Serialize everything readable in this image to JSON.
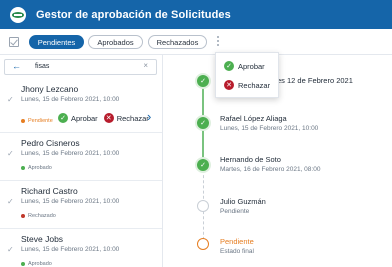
{
  "header": {
    "title": "Gestor de aprobación de Solicitudes"
  },
  "toolbar": {
    "tabs": [
      {
        "label": "Pendientes"
      },
      {
        "label": "Aprobados"
      },
      {
        "label": "Rechazados"
      }
    ]
  },
  "search": {
    "back_icon": "←",
    "value": "fisas",
    "clear_icon": "×"
  },
  "requests": [
    {
      "name": "Jhony Lezcano",
      "date": "Lunes, 15 de Febrero 2021, 10:00",
      "status": "Pendiente",
      "status_color": "#e67e22"
    },
    {
      "name": "Pedro Cisneros",
      "date": "Lunes, 15 de Febrero 2021, 10:00",
      "status": "Aprobado",
      "status_color": "#4caf50"
    },
    {
      "name": "Richard Castro",
      "date": "Lunes, 15 de Febrero 2021, 10:00",
      "status": "Rechazado",
      "status_color": "#c0392b"
    },
    {
      "name": "Steve Jobs",
      "date": "Lunes, 15 de Febrero 2021, 10:00",
      "status": "Aprobado",
      "status_color": "#4caf50"
    }
  ],
  "quick_actions": {
    "approve": "Aprobar",
    "reject": "Rechazar"
  },
  "popup_menu": {
    "approve": "Aprobar",
    "reject": "Rechazar"
  },
  "timeline": [
    {
      "name": "",
      "date": "es 12 de Febrero 2021"
    },
    {
      "name": "Rafael López Aliaga",
      "date": "Lunes, 15 de Febrero 2021, 10:00"
    },
    {
      "name": "Hernando de Soto",
      "date": "Martes, 16 de Febrero 2021, 08:00"
    },
    {
      "name": "Julio Guzmán",
      "date": "Pendiente"
    },
    {
      "name": "Pendiente",
      "date": "Estado final"
    }
  ],
  "colors": {
    "brand": "#1565a9",
    "approved": "#4caf50",
    "rejected": "#b71c2c",
    "pending": "#e67e22"
  }
}
